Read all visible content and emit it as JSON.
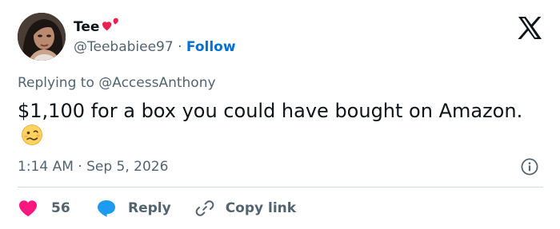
{
  "tweet": {
    "author": {
      "display_name": "Tee",
      "name_emoji": "hearts-emoji",
      "handle": "@Teebabiee97",
      "separator": "·",
      "follow_label": "Follow"
    },
    "platform_icon": "x-logo-icon",
    "reply_context": {
      "prefix": "Replying to ",
      "mention": "@AccessAnthony"
    },
    "text": "$1,100 for a box you could have bought on Amazon.",
    "text_emoji": "woozy-face-emoji",
    "timestamp": {
      "time": "1:14 AM",
      "separator": "·",
      "date": "Sep 5, 2026"
    },
    "info_icon": "info-icon",
    "actions": {
      "like_count": "56",
      "reply_label": "Reply",
      "copy_link_label": "Copy link"
    },
    "colors": {
      "like": "#f91880",
      "reply": "#1d9bf0",
      "follow": "#006fd6",
      "secondary_text": "#536471"
    }
  }
}
